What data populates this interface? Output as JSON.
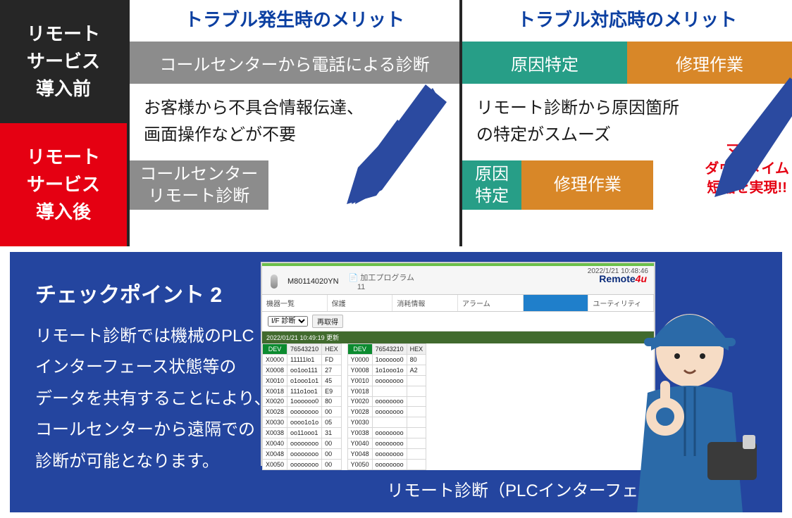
{
  "side": {
    "before": "リモート\nサービス\n導入前",
    "after": "リモート\nサービス\n導入後"
  },
  "col1": {
    "header": "トラブル発生時のメリット",
    "before_bar": "コールセンターから電話による診断",
    "desc": "お客様から不具合情報伝達、\n画面操作などが不要",
    "after_bar": "コールセンター\nリモート診断"
  },
  "col2": {
    "header": "トラブル対応時のメリット",
    "before_bar": {
      "a": "原因特定",
      "b": "修理作業"
    },
    "desc": "リモート診断から原因箇所\nの特定がスムーズ",
    "after_bar": {
      "a": "原因\n特定",
      "b": "修理作業"
    },
    "callout": "マシン\nダウンタイム\n短縮を実現!!"
  },
  "checkpoint": {
    "title": "チェックポイント 2",
    "body": "リモート診断では機械のPLC\nインターフェース状態等の\nデータを共有することにより、\nコールセンターから遠隔での\n診断が可能となります。",
    "caption": "リモート診断（PLCインターフェース）画面"
  },
  "app": {
    "clock": "2022/1/21 10:48:46",
    "machine_id": "M80114020YN",
    "program_label": "加工プログラム",
    "program_no": "11",
    "logo": "Remote4u",
    "tabs": [
      "機器一覧",
      "保護",
      "消耗情報",
      "アラーム",
      "",
      "ユーティリティ"
    ],
    "active_tab_index": 4,
    "dropdown": "I/F 診断",
    "refresh": "再取得",
    "status": "2022/01/21 10:49:19 更新",
    "table_headers": [
      "DEV",
      "76543210",
      "HEX"
    ],
    "left_rows": [
      [
        "X0000",
        "11111lo1",
        "FD"
      ],
      [
        "X0008",
        "oo1oo111",
        "27"
      ],
      [
        "X0010",
        "o1ooo1o1",
        "45"
      ],
      [
        "X0018",
        "111o1oo1",
        "E9"
      ],
      [
        "X0020",
        "1oooooo0",
        "80"
      ],
      [
        "X0028",
        "oooooooo",
        "00"
      ],
      [
        "X0030",
        "oooo1o1o",
        "05"
      ],
      [
        "X0038",
        "oo11ooo1",
        "31"
      ],
      [
        "X0040",
        "oooooooo",
        "00"
      ],
      [
        "X0048",
        "oooooooo",
        "00"
      ],
      [
        "X0050",
        "oooooooo",
        "00"
      ]
    ],
    "right_rows": [
      [
        "Y0000",
        "1oooooo0",
        "80"
      ],
      [
        "Y0008",
        "1o1ooo1o",
        "A2"
      ],
      [
        "Y0010",
        "oooooooo",
        ""
      ],
      [
        "Y0018",
        "",
        ""
      ],
      [
        "Y0020",
        "oooooooo",
        ""
      ],
      [
        "Y0028",
        "oooooooo",
        ""
      ],
      [
        "Y0030",
        "",
        ""
      ],
      [
        "Y0038",
        "oooooooo",
        ""
      ],
      [
        "Y0040",
        "oooooooo",
        ""
      ],
      [
        "Y0048",
        "oooooooo",
        ""
      ],
      [
        "Y0050",
        "oooooooo",
        ""
      ]
    ]
  }
}
